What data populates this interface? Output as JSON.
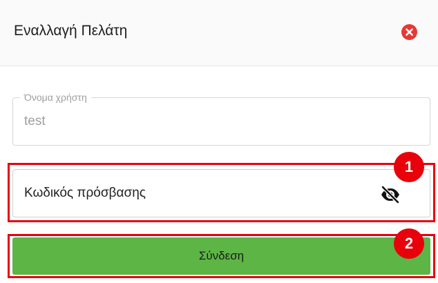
{
  "dialog": {
    "title": "Εναλλαγή Πελάτη",
    "close_icon": "close-circle-icon"
  },
  "username": {
    "label": "Όνομα χρήστη",
    "value": "test"
  },
  "password": {
    "placeholder": "Κωδικός πρόσβασης",
    "toggle_icon": "eye-off-icon"
  },
  "submit": {
    "label": "Σύνδεση"
  },
  "annotations": {
    "marker_1": "1",
    "marker_2": "2"
  },
  "colors": {
    "accent_red": "#e8000b",
    "close_red": "#e53935",
    "button_green": "#5cb545",
    "muted_text": "#9e9e9e"
  }
}
